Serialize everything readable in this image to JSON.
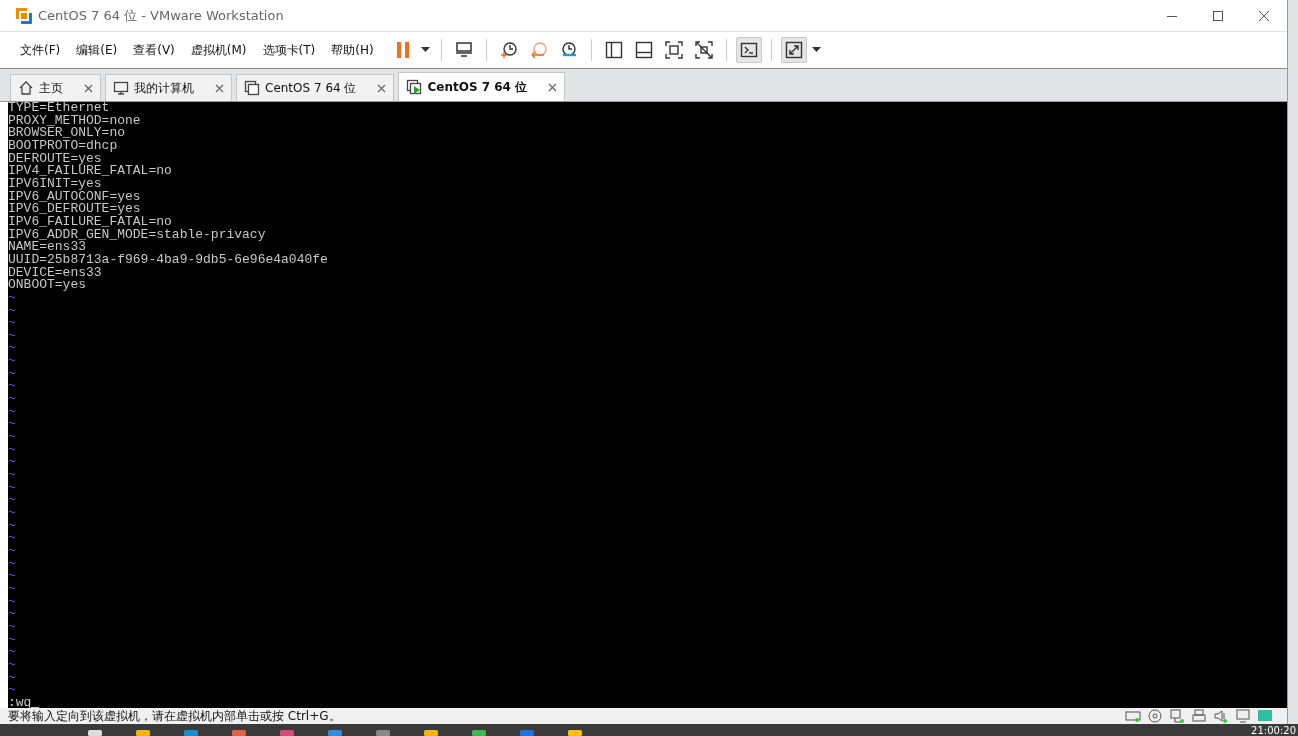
{
  "window": {
    "title": "CentOS 7 64 位 - VMware Workstation"
  },
  "menu": [
    "文件(F)",
    "编辑(E)",
    "查看(V)",
    "虚拟机(M)",
    "选项卡(T)",
    "帮助(H)"
  ],
  "toolbar": [
    {
      "kind": "pause"
    },
    {
      "kind": "caret"
    },
    {
      "kind": "sep"
    },
    {
      "kind": "send"
    },
    {
      "kind": "sep"
    },
    {
      "kind": "snap"
    },
    {
      "kind": "revert"
    },
    {
      "kind": "manager"
    },
    {
      "kind": "sep"
    },
    {
      "kind": "lib"
    },
    {
      "kind": "thumb"
    },
    {
      "kind": "full"
    },
    {
      "kind": "unity"
    },
    {
      "kind": "sep"
    },
    {
      "kind": "console",
      "pressed": true
    },
    {
      "kind": "sep"
    },
    {
      "kind": "stretch",
      "pressed": true
    },
    {
      "kind": "caret"
    }
  ],
  "tabs": [
    {
      "label": "主页",
      "kind": "home",
      "selected": false
    },
    {
      "label": "我的计算机",
      "kind": "computer",
      "selected": false
    },
    {
      "label": "CentOS 7 64 位",
      "kind": "vm",
      "selected": false
    },
    {
      "label": "CentOS 7 64 位",
      "kind": "vm-running",
      "selected": true
    }
  ],
  "terminal": {
    "lines": [
      "TYPE=Ethernet",
      "PROXY_METHOD=none",
      "BROWSER_ONLY=no",
      "BOOTPROTO=dhcp",
      "DEFROUTE=yes",
      "IPV4_FAILURE_FATAL=no",
      "IPV6INIT=yes",
      "IPV6_AUTOCONF=yes",
      "IPV6_DEFROUTE=yes",
      "IPV6_FAILURE_FATAL=no",
      "IPV6_ADDR_GEN_MODE=stable-privacy",
      "NAME=ens33",
      "UUID=25b8713a-f969-4ba9-9db5-6e96e4a040fe",
      "DEVICE=ens33",
      "ONBOOT=yes"
    ],
    "tildes": [
      "~",
      "~",
      "~",
      "~",
      "~",
      "~",
      "~",
      "~",
      "~",
      "~",
      "~",
      "~",
      "~",
      "~",
      "~",
      "~",
      "~",
      "~",
      "~",
      "~",
      "~",
      "~",
      "~",
      "~",
      "~",
      "~",
      "~",
      "~",
      "~",
      "~",
      "~",
      "~"
    ],
    "command": ":wq"
  },
  "status_bar": {
    "message": "要将输入定向到该虚拟机，请在虚拟机内部单击或按 Ctrl+G。"
  },
  "taskbar": {
    "clock": "21:00:20"
  }
}
